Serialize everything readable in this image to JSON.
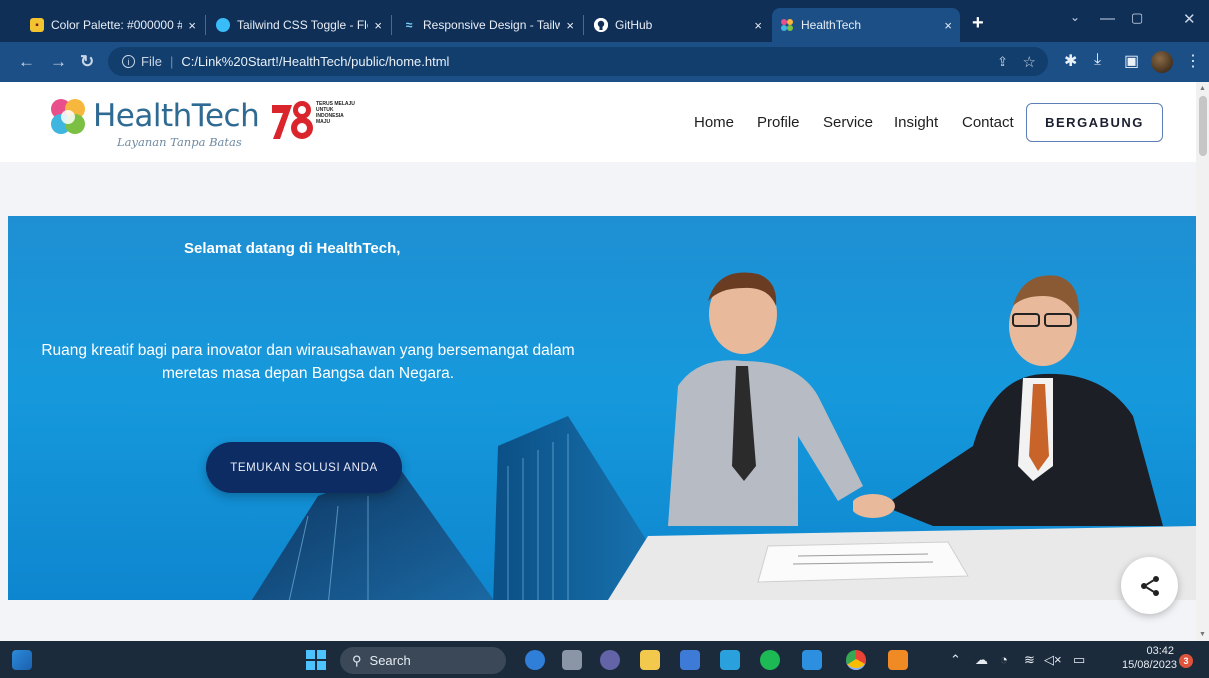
{
  "browser": {
    "tabs": [
      {
        "title": "Color Palette: #000000 #4",
        "active": false
      },
      {
        "title": "Tailwind CSS Toggle - Flov",
        "active": false
      },
      {
        "title": "Responsive Design - Tailw",
        "active": false
      },
      {
        "title": "GitHub",
        "active": false
      },
      {
        "title": "HealthTech",
        "active": true
      }
    ],
    "close_glyph": "×",
    "new_tab_glyph": "+",
    "address": {
      "scheme_label": "File",
      "url": "C:/Link%20Start!/HealthTech/public/home.html"
    }
  },
  "site": {
    "brand": "HealthTech",
    "tagline": "Layanan Tanpa Batas",
    "anniversary_text": "TERUS MELAJU UNTUK INDONESIA MAJU",
    "nav": [
      "Home",
      "Profile",
      "Service",
      "Insight",
      "Contact"
    ],
    "join_label": "BERGABUNG",
    "hero": {
      "welcome": "Selamat datang di HealthTech,",
      "subtitle": "Ruang kreatif bagi para inovator dan wirausahawan yang bersemangat dalam meretas masa depan Bangsa dan Negara.",
      "cta": "TEMUKAN SOLUSI ANDA"
    }
  },
  "taskbar": {
    "search_label": "Search",
    "time": "03:42",
    "date": "15/08/2023",
    "notification_count": "3"
  },
  "colors": {
    "tab_strip": "#0f2f57",
    "toolbar": "#1b4f86",
    "hero_blue": "#1699dc",
    "cta_navy": "#0c2c63",
    "brand_text": "#2f6a93",
    "taskbar": "#1c2b3c"
  }
}
